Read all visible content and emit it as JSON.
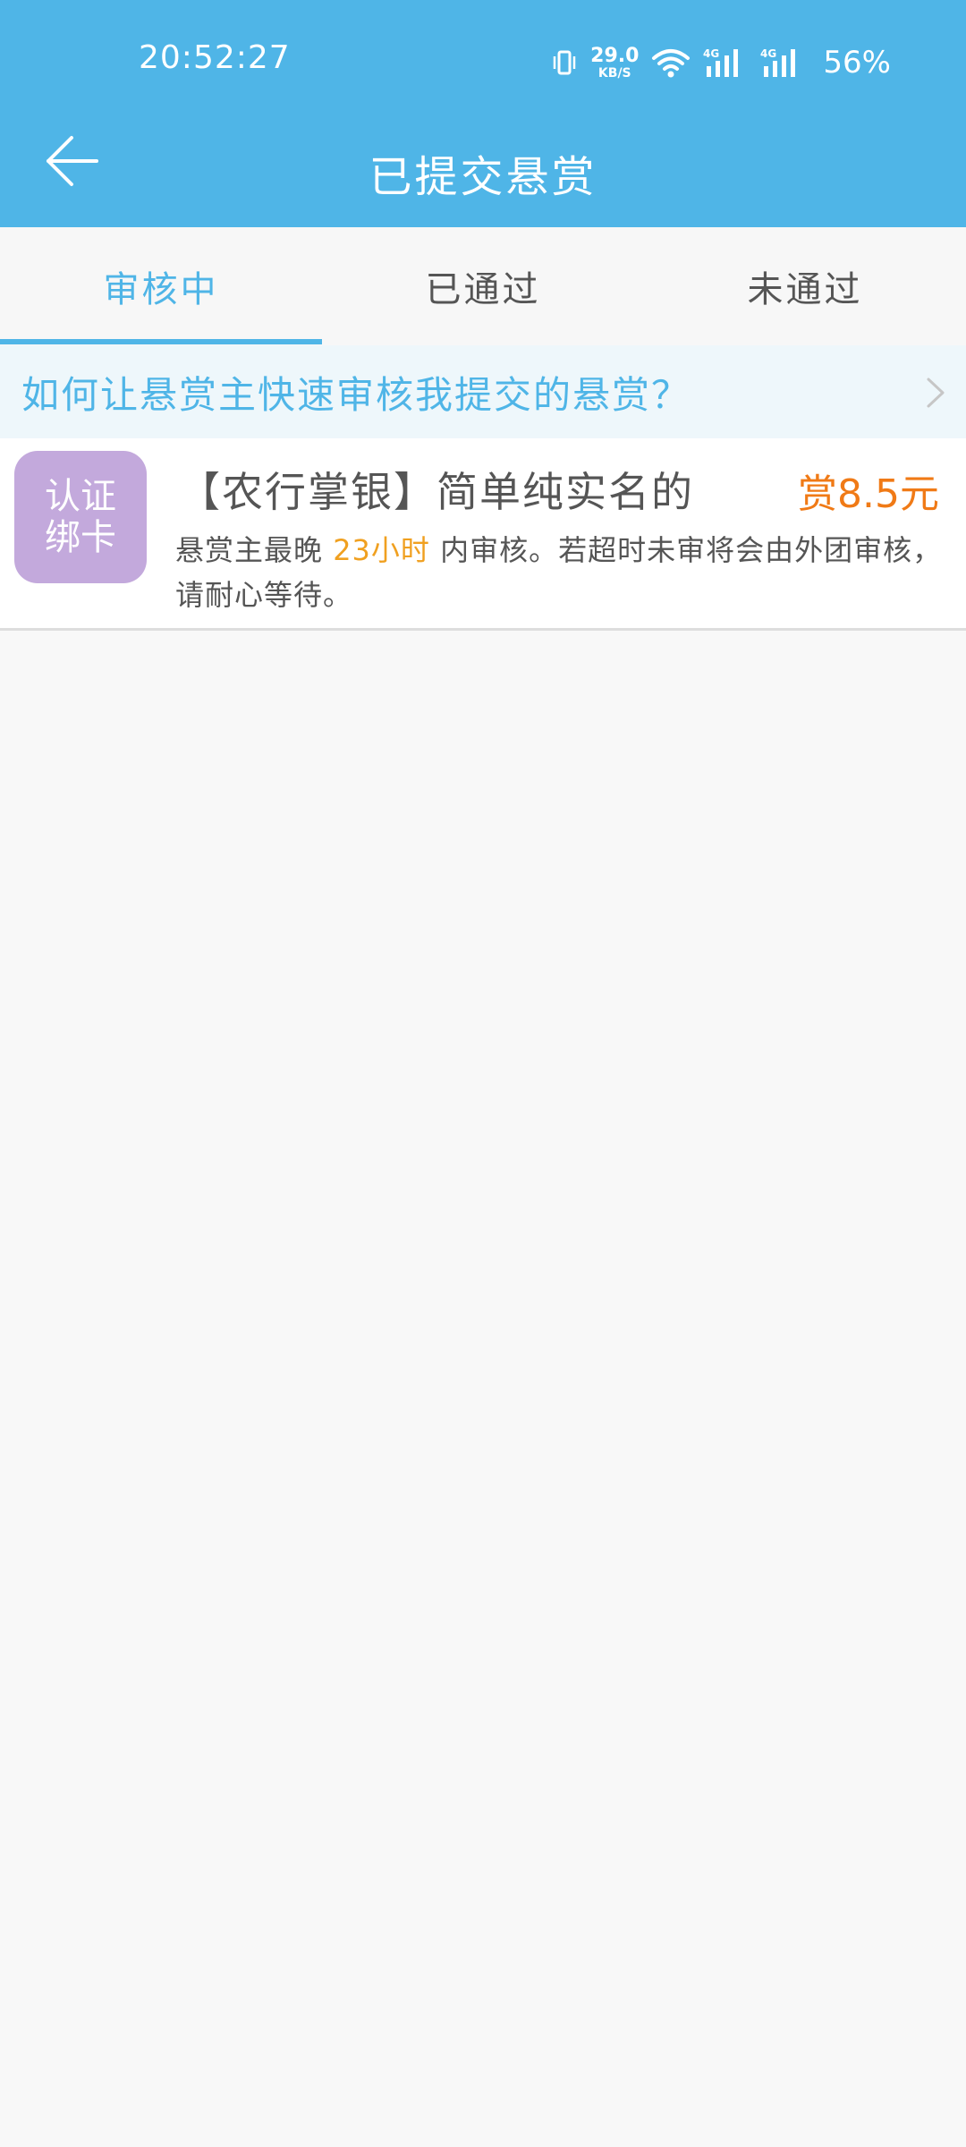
{
  "status_bar": {
    "time": "20:52:27",
    "net_speed_value": "29.0",
    "net_speed_unit": "KB/S",
    "signal1_label": "4G",
    "signal2_label": "4G",
    "battery": "56%"
  },
  "header": {
    "title": "已提交悬赏",
    "back_icon": "arrow-left-icon",
    "background_color": "#4fb5e7"
  },
  "tabs": [
    {
      "label": "审核中",
      "active": true
    },
    {
      "label": "已通过",
      "active": false
    },
    {
      "label": "未通过",
      "active": false
    }
  ],
  "tip_banner": {
    "text": "如何让悬赏主快速审核我提交的悬赏？",
    "icon": "chevron-right-icon"
  },
  "tasks": [
    {
      "thumb_line1": "认证",
      "thumb_line2": "绑卡",
      "thumb_color": "#c3a9dc",
      "title": "【农行掌银】简单纯实名的",
      "reward": "赏8.5元",
      "desc_prefix": "悬赏主最晚",
      "desc_highlight": "23小时",
      "desc_suffix": "内审核。若超时未审将会由外团审核，请耐心等待。"
    }
  ],
  "colors": {
    "accent": "#4fb5e7",
    "reward": "#f07a16",
    "highlight": "#f0a020"
  }
}
